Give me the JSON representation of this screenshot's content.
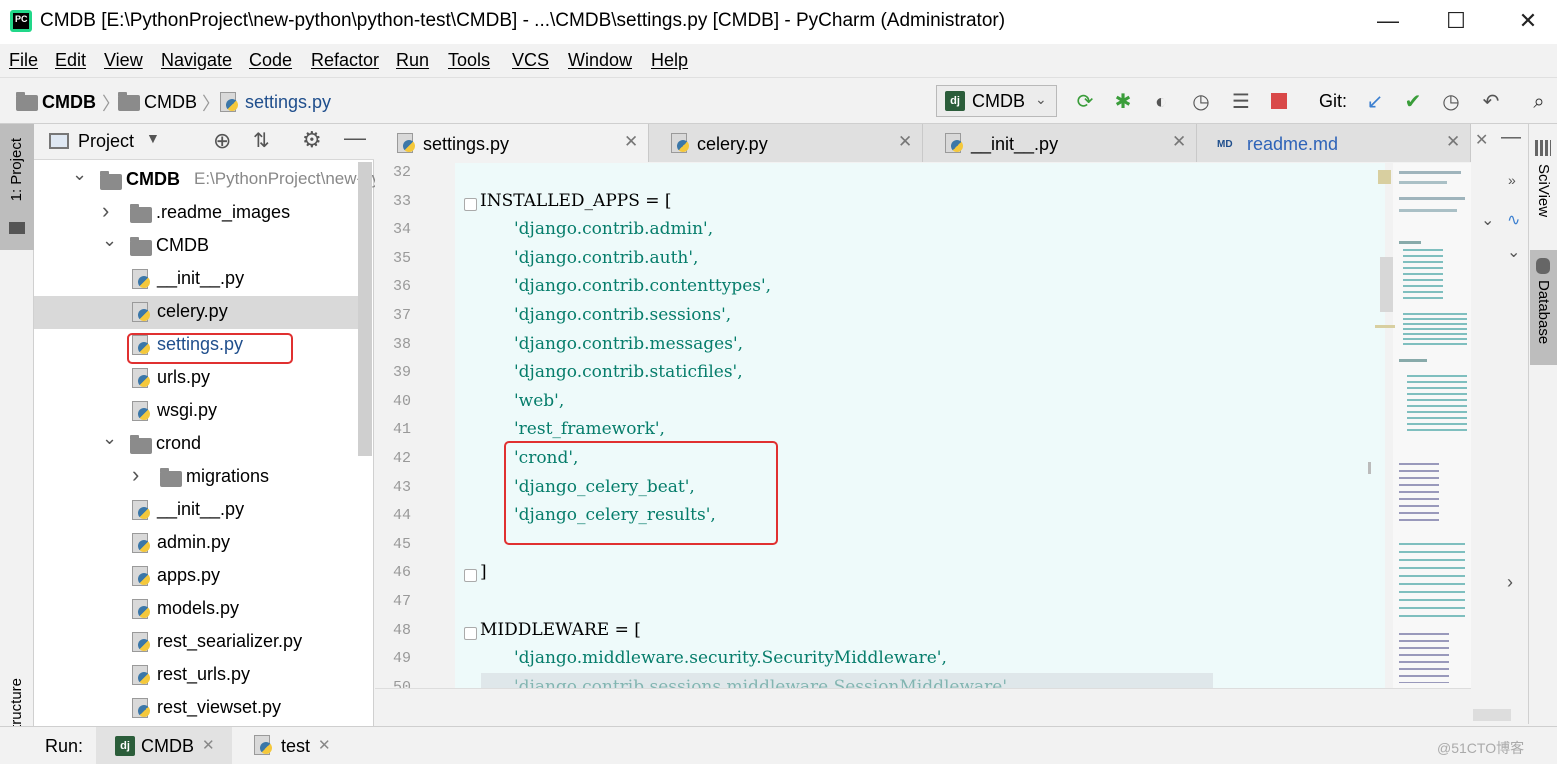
{
  "window": {
    "title": "CMDB [E:\\PythonProject\\new-python\\python-test\\CMDB] - ...\\CMDB\\settings.py [CMDB] - PyCharm (Administrator)",
    "app_icon_text": "PC",
    "minimize": "—",
    "maximize": "☐",
    "close": "✕"
  },
  "menu": [
    "File",
    "Edit",
    "View",
    "Navigate",
    "Code",
    "Refactor",
    "Run",
    "Tools",
    "VCS",
    "Window",
    "Help"
  ],
  "breadcrumb": [
    "CMDB",
    "CMDB",
    "settings.py"
  ],
  "toolbar": {
    "run_config": "CMDB",
    "dj": "dj",
    "git_label": "Git:"
  },
  "left_strip": {
    "project_tab": "1: Project",
    "structure_tab": "Z: Structure"
  },
  "project_panel": {
    "title": "Project",
    "tree": [
      {
        "label": "CMDB",
        "extra": "E:\\PythonProject\\new-pytho",
        "kind": "folder",
        "depth": 0,
        "expanded": true
      },
      {
        "label": ".readme_images",
        "kind": "folder",
        "depth": 1,
        "expanded": false
      },
      {
        "label": "CMDB",
        "kind": "folder",
        "depth": 1,
        "expanded": true
      },
      {
        "label": "__init__.py",
        "kind": "py",
        "depth": 2
      },
      {
        "label": "celery.py",
        "kind": "py",
        "depth": 2,
        "selected": true
      },
      {
        "label": "settings.py",
        "kind": "py",
        "depth": 2,
        "highlighted": true
      },
      {
        "label": "urls.py",
        "kind": "py",
        "depth": 2
      },
      {
        "label": "wsgi.py",
        "kind": "py",
        "depth": 2
      },
      {
        "label": "crond",
        "kind": "folder",
        "depth": 1,
        "expanded": true
      },
      {
        "label": "migrations",
        "kind": "folder",
        "depth": 2,
        "expanded": false
      },
      {
        "label": "__init__.py",
        "kind": "py",
        "depth": 2
      },
      {
        "label": "admin.py",
        "kind": "py",
        "depth": 2
      },
      {
        "label": "apps.py",
        "kind": "py",
        "depth": 2
      },
      {
        "label": "models.py",
        "kind": "py",
        "depth": 2
      },
      {
        "label": "rest_searializer.py",
        "kind": "py",
        "depth": 2
      },
      {
        "label": "rest_urls.py",
        "kind": "py",
        "depth": 2
      },
      {
        "label": "rest_viewset.py",
        "kind": "py",
        "depth": 2
      }
    ]
  },
  "editor_tabs": [
    {
      "label": "settings.py",
      "active": true,
      "close": "✕"
    },
    {
      "label": "celery.py",
      "active": false,
      "close": "✕"
    },
    {
      "label": "__init__.py",
      "active": false,
      "close": "✕"
    },
    {
      "label": "readme.md",
      "active": false,
      "close": "✕",
      "badge": "MD"
    }
  ],
  "code": {
    "lines": [
      {
        "n": "32",
        "text": ""
      },
      {
        "n": "33",
        "text": "INSTALLED_APPS = [",
        "plain": true
      },
      {
        "n": "34",
        "text": "'django.contrib.admin',"
      },
      {
        "n": "35",
        "text": "'django.contrib.auth',"
      },
      {
        "n": "36",
        "text": "'django.contrib.contenttypes',"
      },
      {
        "n": "37",
        "text": "'django.contrib.sessions',"
      },
      {
        "n": "38",
        "text": "'django.contrib.messages',"
      },
      {
        "n": "39",
        "text": "'django.contrib.staticfiles',"
      },
      {
        "n": "40",
        "text": "'web',"
      },
      {
        "n": "41",
        "text": "'rest_framework',"
      },
      {
        "n": "42",
        "text": "'crond',"
      },
      {
        "n": "43",
        "text": "'django_celery_beat',"
      },
      {
        "n": "44",
        "text": "'django_celery_results',"
      },
      {
        "n": "45",
        "text": ""
      },
      {
        "n": "46",
        "text": "]",
        "plain": true
      },
      {
        "n": "47",
        "text": ""
      },
      {
        "n": "48",
        "text": "MIDDLEWARE = [",
        "plain": true
      },
      {
        "n": "49",
        "text": "'django.middleware.security.SecurityMiddleware',"
      },
      {
        "n": "50",
        "text": "'django.contrib.sessions.middleware.SessionMiddleware',"
      }
    ]
  },
  "right_strip": {
    "sciview": "SciView",
    "database": "Database"
  },
  "run_bar": {
    "label": "Run:",
    "tabs": [
      "CMDB",
      "test"
    ],
    "watermark": "@51CTO博客"
  }
}
